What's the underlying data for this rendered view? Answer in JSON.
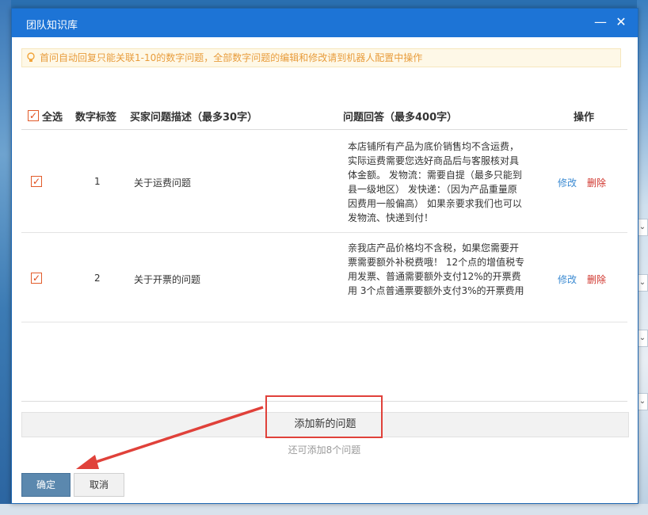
{
  "dialog": {
    "title": "团队知识库",
    "minimize_glyph": "—",
    "close_glyph": "✕"
  },
  "tip": {
    "icon": "lightbulb-icon",
    "text": "首问自动回复只能关联1-10的数字问题，全部数字问题的编辑和修改请到机器人配置中操作"
  },
  "table": {
    "headers": {
      "select_all": "全选",
      "number_tag": "数字标签",
      "question_desc": "买家问题描述（最多30字）",
      "answer": "问题回答（最多400字）",
      "actions": "操作"
    },
    "rows": [
      {
        "checked": true,
        "number": "1",
        "question": "关于运费问题",
        "answer": "本店铺所有产品为底价销售均不含运费，实际运费需要您选好商品后与客服核对具体金额。 发物流：需要自提（最多只能到县一级地区） 发快递：（因为产品重量原因费用一般偏高） 如果亲要求我们也可以发物流、快递到付！",
        "edit": "修改",
        "delete": "删除"
      },
      {
        "checked": true,
        "number": "2",
        "question": "关于开票的问题",
        "answer": "亲我店产品价格均不含税，如果您需要开票需要额外补税费哦！ 12个点的增值税专用发票、普通需要额外支付12%的开票费用 3个点普通票要额外支付3%的开票费用",
        "edit": "修改",
        "delete": "删除"
      }
    ]
  },
  "add_button": "添加新的问题",
  "remaining_text": "还可添加8个问题",
  "buttons": {
    "ok": "确定",
    "cancel": "取消"
  },
  "colors": {
    "titlebar": "#1d74d6",
    "tip_background": "#fef8e7",
    "tip_text": "#e89c3c",
    "edit_link": "#3c8bd2",
    "delete_link": "#d0342c",
    "annotation_red": "#e0413a",
    "ok_button": "#5b88ae"
  }
}
